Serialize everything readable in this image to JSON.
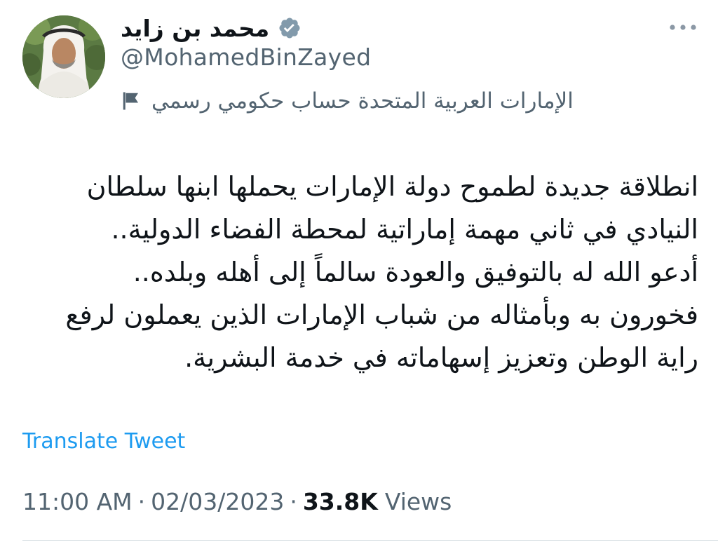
{
  "author": {
    "display_name": "محمد بن زايد",
    "handle": "@MohamedBinZayed",
    "verified_icon": "verified-badge-icon",
    "avatar_icon": "profile-photo",
    "label_icon": "flag-icon",
    "label_text": "الإمارات العربية المتحدة حساب حكومي رسمي"
  },
  "more_icon": "more-options-icon",
  "tweet": {
    "lines": [
      "انطلاقة جديدة لطموح دولة الإمارات يحملها ابنها سلطان",
      "النيادي في ثاني مهمة إماراتية لمحطة الفضاء الدولية..",
      "أدعو الله له بالتوفيق والعودة سالماً إلى أهله وبلده..",
      "فخورون به وبأمثاله من شباب الإمارات الذين يعملون لرفع",
      "راية الوطن وتعزيز إسهاماته في خدمة البشرية."
    ]
  },
  "translate_label": "Translate Tweet",
  "meta": {
    "time": "11:00 AM",
    "separator": "·",
    "date": "02/03/2023",
    "views_count": "33.8K",
    "views_label": "Views"
  },
  "colors": {
    "text_primary": "#0f1419",
    "text_secondary": "#536471",
    "link": "#1d9bf0",
    "verified": "#829aab"
  }
}
